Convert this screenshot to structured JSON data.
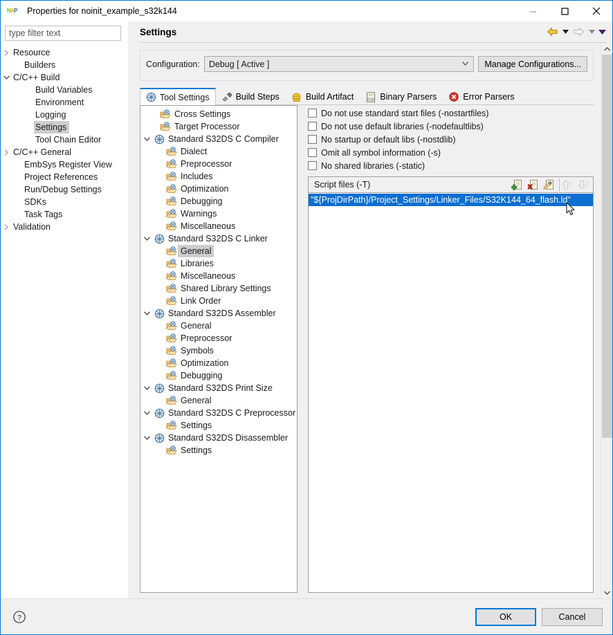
{
  "window": {
    "title": "Properties for noinit_example_s32k144",
    "logo_letters": [
      "N",
      "X",
      "P"
    ],
    "controls": {
      "minimize": "minimize-icon",
      "maximize": "maximize-icon",
      "close": "close-icon"
    }
  },
  "filter": {
    "placeholder": "type filter text",
    "value": ""
  },
  "nav_tree": [
    {
      "label": "Resource",
      "indent": 0,
      "twisty": "collapsed",
      "selected": false
    },
    {
      "label": "Builders",
      "indent": 1,
      "twisty": "none",
      "selected": false
    },
    {
      "label": "C/C++ Build",
      "indent": 0,
      "twisty": "expanded",
      "selected": false
    },
    {
      "label": "Build Variables",
      "indent": 2,
      "twisty": "none",
      "selected": false
    },
    {
      "label": "Environment",
      "indent": 2,
      "twisty": "none",
      "selected": false
    },
    {
      "label": "Logging",
      "indent": 2,
      "twisty": "none",
      "selected": false
    },
    {
      "label": "Settings",
      "indent": 2,
      "twisty": "none",
      "selected": true
    },
    {
      "label": "Tool Chain Editor",
      "indent": 2,
      "twisty": "none",
      "selected": false
    },
    {
      "label": "C/C++ General",
      "indent": 0,
      "twisty": "collapsed",
      "selected": false
    },
    {
      "label": "EmbSys Register View",
      "indent": 1,
      "twisty": "none",
      "selected": false
    },
    {
      "label": "Project References",
      "indent": 1,
      "twisty": "none",
      "selected": false
    },
    {
      "label": "Run/Debug Settings",
      "indent": 1,
      "twisty": "none",
      "selected": false
    },
    {
      "label": "SDKs",
      "indent": 1,
      "twisty": "none",
      "selected": false
    },
    {
      "label": "Task Tags",
      "indent": 1,
      "twisty": "none",
      "selected": false
    },
    {
      "label": "Validation",
      "indent": 0,
      "twisty": "collapsed",
      "selected": false
    }
  ],
  "pane": {
    "title": "Settings",
    "nav": {
      "back_icon": "back-arrow-icon",
      "back_menu_icon": "chevron-down-icon",
      "forward_icon": "forward-arrow-icon",
      "forward_menu_icon": "chevron-down-icon",
      "view_menu_icon": "triangle-down-icon"
    }
  },
  "configuration": {
    "label": "Configuration:",
    "value": "Debug  [ Active ]",
    "dropdown_icon": "chevron-down-icon",
    "manage_button": "Manage Configurations..."
  },
  "tabs": [
    {
      "label": "Tool Settings",
      "icon": "tool-settings-icon",
      "active": true
    },
    {
      "label": "Build Steps",
      "icon": "build-steps-icon",
      "active": false
    },
    {
      "label": "Build Artifact",
      "icon": "build-artifact-icon",
      "active": false
    },
    {
      "label": "Binary Parsers",
      "icon": "binary-parsers-icon",
      "active": false
    },
    {
      "label": "Error Parsers",
      "icon": "error-parsers-icon",
      "active": false
    }
  ],
  "tool_tree": [
    {
      "label": "Cross Settings",
      "indent": 1,
      "twisty": "none",
      "icon": "folder-tool-icon",
      "selected": false
    },
    {
      "label": "Target Processor",
      "indent": 1,
      "twisty": "none",
      "icon": "folder-tool-icon",
      "selected": false
    },
    {
      "label": "Standard S32DS C Compiler",
      "indent": 0,
      "twisty": "expanded",
      "icon": "tool-globe-icon",
      "selected": false
    },
    {
      "label": "Dialect",
      "indent": 2,
      "twisty": "none",
      "icon": "folder-tool-icon",
      "selected": false
    },
    {
      "label": "Preprocessor",
      "indent": 2,
      "twisty": "none",
      "icon": "folder-tool-icon",
      "selected": false
    },
    {
      "label": "Includes",
      "indent": 2,
      "twisty": "none",
      "icon": "folder-tool-icon",
      "selected": false
    },
    {
      "label": "Optimization",
      "indent": 2,
      "twisty": "none",
      "icon": "folder-tool-icon",
      "selected": false
    },
    {
      "label": "Debugging",
      "indent": 2,
      "twisty": "none",
      "icon": "folder-tool-icon",
      "selected": false
    },
    {
      "label": "Warnings",
      "indent": 2,
      "twisty": "none",
      "icon": "folder-tool-icon",
      "selected": false
    },
    {
      "label": "Miscellaneous",
      "indent": 2,
      "twisty": "none",
      "icon": "folder-tool-icon",
      "selected": false
    },
    {
      "label": "Standard S32DS C Linker",
      "indent": 0,
      "twisty": "expanded",
      "icon": "tool-globe-icon",
      "selected": false
    },
    {
      "label": "General",
      "indent": 2,
      "twisty": "none",
      "icon": "folder-tool-icon",
      "selected": true
    },
    {
      "label": "Libraries",
      "indent": 2,
      "twisty": "none",
      "icon": "folder-tool-icon",
      "selected": false
    },
    {
      "label": "Miscellaneous",
      "indent": 2,
      "twisty": "none",
      "icon": "folder-tool-icon",
      "selected": false
    },
    {
      "label": "Shared Library Settings",
      "indent": 2,
      "twisty": "none",
      "icon": "folder-tool-icon",
      "selected": false
    },
    {
      "label": "Link Order",
      "indent": 2,
      "twisty": "none",
      "icon": "folder-tool-icon",
      "selected": false
    },
    {
      "label": "Standard S32DS Assembler",
      "indent": 0,
      "twisty": "expanded",
      "icon": "tool-globe-icon",
      "selected": false
    },
    {
      "label": "General",
      "indent": 2,
      "twisty": "none",
      "icon": "folder-tool-icon",
      "selected": false
    },
    {
      "label": "Preprocessor",
      "indent": 2,
      "twisty": "none",
      "icon": "folder-tool-icon",
      "selected": false
    },
    {
      "label": "Symbols",
      "indent": 2,
      "twisty": "none",
      "icon": "folder-tool-icon",
      "selected": false
    },
    {
      "label": "Optimization",
      "indent": 2,
      "twisty": "none",
      "icon": "folder-tool-icon",
      "selected": false
    },
    {
      "label": "Debugging",
      "indent": 2,
      "twisty": "none",
      "icon": "folder-tool-icon",
      "selected": false
    },
    {
      "label": "Standard S32DS Print Size",
      "indent": 0,
      "twisty": "expanded",
      "icon": "tool-globe-icon",
      "selected": false
    },
    {
      "label": "General",
      "indent": 2,
      "twisty": "none",
      "icon": "folder-tool-icon",
      "selected": false
    },
    {
      "label": "Standard S32DS C Preprocessor",
      "indent": 0,
      "twisty": "expanded",
      "icon": "tool-globe-icon",
      "selected": false
    },
    {
      "label": "Settings",
      "indent": 2,
      "twisty": "none",
      "icon": "folder-tool-icon",
      "selected": false
    },
    {
      "label": "Standard S32DS Disassembler",
      "indent": 0,
      "twisty": "expanded",
      "icon": "tool-globe-icon",
      "selected": false
    },
    {
      "label": "Settings",
      "indent": 2,
      "twisty": "none",
      "icon": "folder-tool-icon",
      "selected": false
    }
  ],
  "options": {
    "checkboxes": [
      {
        "label": "Do not use standard start files (-nostartfiles)",
        "checked": false
      },
      {
        "label": "Do not use default libraries (-nodefaultlibs)",
        "checked": false
      },
      {
        "label": "No startup or default libs (-nostdlib)",
        "checked": false
      },
      {
        "label": "Omit all symbol information (-s)",
        "checked": false
      },
      {
        "label": "No shared libraries (-static)",
        "checked": false
      }
    ],
    "script_files": {
      "header": "Script files (-T)",
      "tools": [
        {
          "name": "add-icon",
          "enabled": true
        },
        {
          "name": "delete-icon",
          "enabled": true
        },
        {
          "name": "edit-icon",
          "enabled": true
        },
        {
          "name": "move-up-icon",
          "enabled": false
        },
        {
          "name": "move-down-icon",
          "enabled": false
        }
      ],
      "items": [
        {
          "value": "\"${ProjDirPath}/Project_Settings/Linker_Files/S32K144_64_flash.ld\"",
          "selected": true
        }
      ]
    }
  },
  "footer": {
    "help_icon": "help-icon",
    "ok": "OK",
    "cancel": "Cancel"
  },
  "colors": {
    "accent": "#0078d7",
    "selection": "#0b6ed1",
    "tree_selection": "#cdcdcd",
    "window_bg": "#f0f0f0"
  }
}
